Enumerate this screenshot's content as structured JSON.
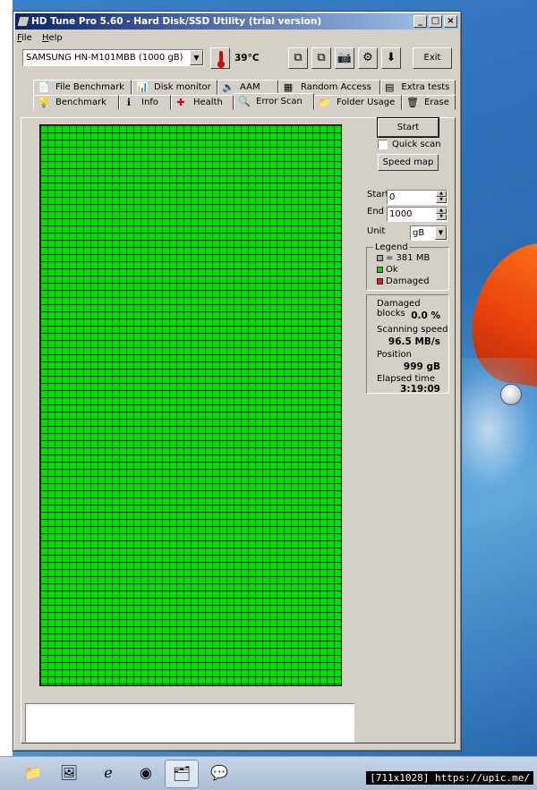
{
  "window": {
    "title": "HD Tune Pro 5.60 - Hard Disk/SSD Utility (trial version)",
    "controls": [
      "_",
      "□",
      "×"
    ]
  },
  "menu": [
    "File",
    "Help"
  ],
  "toolbar": {
    "drive": "SAMSUNG HN-M101MBB (1000 gB)",
    "temperature": "39°C",
    "exit_label": "Exit"
  },
  "tabs_top": [
    {
      "label": "File Benchmark",
      "icon": "file-benchmark-icon",
      "glyph": "📄"
    },
    {
      "label": "Disk monitor",
      "icon": "disk-monitor-icon",
      "glyph": "📊"
    },
    {
      "label": "AAM",
      "icon": "speaker-icon",
      "glyph": "🔈"
    },
    {
      "label": "Random Access",
      "icon": "random-access-icon",
      "glyph": "▦"
    },
    {
      "label": "Extra tests",
      "icon": "extra-tests-icon",
      "glyph": "▤"
    }
  ],
  "tabs_bottom": [
    {
      "label": "Benchmark",
      "icon": "lightbulb-icon",
      "glyph": "💡"
    },
    {
      "label": "Info",
      "icon": "info-icon",
      "glyph": "ℹ"
    },
    {
      "label": "Health",
      "icon": "health-cross-icon",
      "glyph": "✚"
    },
    {
      "label": "Error Scan",
      "icon": "magnifier-icon",
      "glyph": "🔍",
      "active": true
    },
    {
      "label": "Folder Usage",
      "icon": "folder-icon",
      "glyph": "📁"
    },
    {
      "label": "Erase",
      "icon": "trash-icon",
      "glyph": "🗑"
    }
  ],
  "controls": {
    "start_label": "Start",
    "quick_scan_label": "Quick scan",
    "speed_map_label": "Speed map",
    "start_field_label": "Start",
    "start_value": "0",
    "end_field_label": "End",
    "end_value": "1000",
    "unit_label": "Unit",
    "unit_value": "gB"
  },
  "legend": {
    "title": "Legend",
    "block_size": "= 381 MB",
    "ok": "Ok",
    "damaged": "Damaged",
    "colors": {
      "block": "#a0a0a0",
      "ok": "#00e100",
      "damaged": "#e02020"
    }
  },
  "stats": {
    "damaged_blocks_label": "Damaged blocks",
    "damaged_blocks_value": "0.0 %",
    "scanning_speed_label": "Scanning speed",
    "scanning_speed_value": "96.5 MB/s",
    "position_label": "Position",
    "position_value": "999 gB",
    "elapsed_label": "Elapsed time",
    "elapsed_value": "3:19:09"
  },
  "scan_status_color": "#00e100",
  "watermark": "[711x1028] https://upic.me/"
}
